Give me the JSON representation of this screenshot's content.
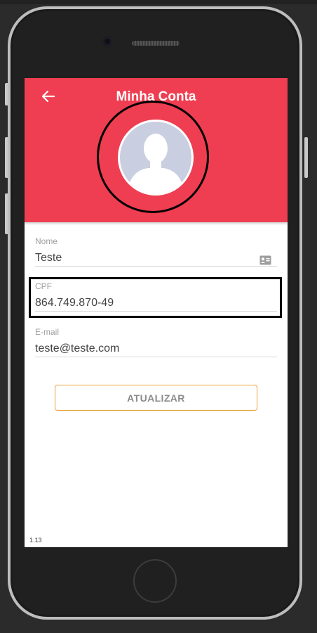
{
  "header": {
    "title": "Minha Conta",
    "back_icon": "arrow-left-icon",
    "background_color": "#ef3e51"
  },
  "avatar": {
    "icon": "user-silhouette-icon"
  },
  "form": {
    "name": {
      "label": "Nome",
      "value": "Teste",
      "icon": "contact-card-icon"
    },
    "cpf": {
      "label": "CPF",
      "value": "864.749.870-49"
    },
    "email": {
      "label": "E-mail",
      "value": "teste@teste.com"
    }
  },
  "actions": {
    "update_label": "ATUALIZAR",
    "accent_color": "#e8a23a"
  },
  "footer": {
    "version": "1.13"
  }
}
